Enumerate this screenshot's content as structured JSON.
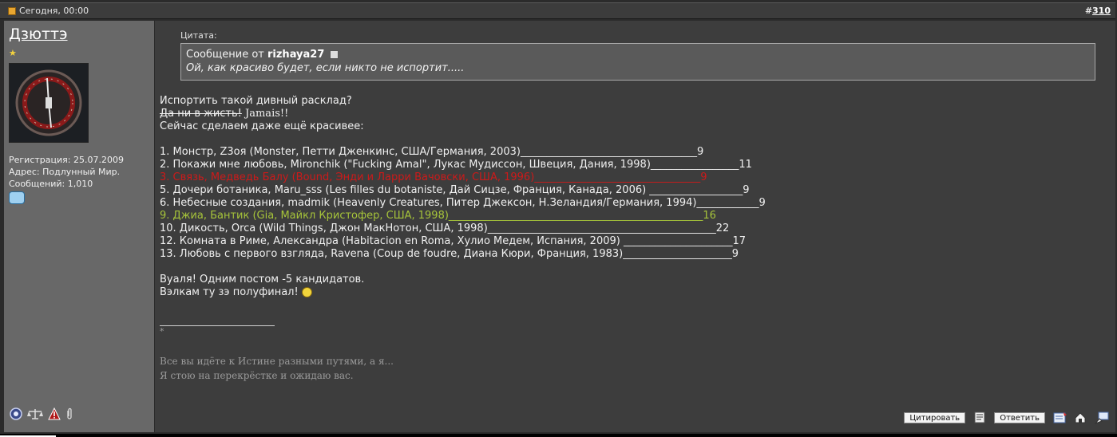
{
  "header": {
    "date": "Сегодня, 00:00",
    "post_prefix": "#",
    "post_number": "310"
  },
  "user": {
    "name": "Дзюттэ",
    "registration": "Регистрация: 25.07.2009",
    "address": "Адрес: Подлунный Мир.",
    "messages": "Сообщений: 1,010"
  },
  "quote": {
    "label": "Цитата:",
    "from_prefix": "Сообщение от",
    "author": "rizhaya27",
    "text": "Ой, как красиво будет, если никто не испортит....."
  },
  "message": {
    "line1": "Испортить такой дивный расклад?",
    "strike": "Да ни в жисть!",
    "jamais": " Jamais!!",
    "line3": "Сейчас сделаем даже ещё красивее:",
    "list": [
      {
        "text": "1. Монстр, Z3оя (Monster, Петти Дженкинс, США/Германия, 2003)__________________________________9",
        "style": "normal"
      },
      {
        "text": "2. Покажи мне любовь, Mironchik (\"Fucking Amal\", Лукас Мудиссон, Швеция, Дания, 1998)_________________11",
        "style": "normal"
      },
      {
        "text": "3. Связь, Медведь Балу (Bound, Энди и Ларри Вачовски, США, 1996)________________________________9",
        "style": "red"
      },
      {
        "text": "5. Дочери ботаника, Maru_sss (Les filles du botaniste, Дай Сицзе, Франция, Канада, 2006) __________________9",
        "style": "normal"
      },
      {
        "text": "6. Небесные создания, madmik (Heavenly Creatures, Питер Джексон, Н.Зеландия/Германия, 1994)____________9",
        "style": "normal"
      },
      {
        "text": "9. Джиа, Бантик (Gia, Майкл Кристофер, США, 1998)_________________________________________________16",
        "style": "green"
      },
      {
        "text": "10. Дикость, Orca (Wild Things, Джон МакНотон, США, 1998)____________________________________________22",
        "style": "normal"
      },
      {
        "text": "12. Комната в Риме, Александра (Habitacion en Roma, Хулио Медем, Испания, 2009) _____________________17",
        "style": "normal"
      },
      {
        "text": "13. Любовь с первого взгляда, Ravena (Coup de foudre, Диана Кюри, Франция, 1983)_____________________9",
        "style": "normal"
      }
    ],
    "closing1": "Вуаля! Одним постом -5 кандидатов.",
    "closing2": "Вэлкам ту зэ полуфинал! "
  },
  "signature": {
    "star": "*",
    "line1": "Все вы идёте к Истине разными путями, а я...",
    "line2": "Я стою на перекрёстке и ожидаю вас."
  },
  "buttons": {
    "quote": "Цитировать",
    "reply": "Ответить"
  },
  "colors": {
    "header_bg": "#3c3c3c",
    "sidebar_bg": "#686868",
    "content_bg": "#3d3d3d",
    "red_row": "#cc1a1a",
    "green_row": "#a6c43a"
  }
}
